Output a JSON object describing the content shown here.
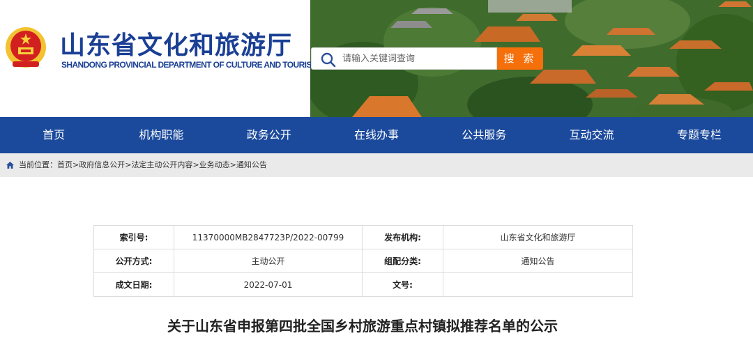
{
  "site": {
    "title_cn": "山东省文化和旅游厅",
    "title_en": "SHANDONG PROVINCIAL DEPARTMENT OF CULTURE AND TOURISM"
  },
  "search": {
    "placeholder": "请输入关键词查询",
    "button_label": "搜 索"
  },
  "nav": {
    "items": [
      {
        "label": "首页"
      },
      {
        "label": "机构职能"
      },
      {
        "label": "政务公开"
      },
      {
        "label": "在线办事"
      },
      {
        "label": "公共服务"
      },
      {
        "label": "互动交流"
      },
      {
        "label": "专题专栏"
      }
    ]
  },
  "breadcrumb": {
    "prefix": "当前位置：",
    "items": [
      "首页",
      "政府信息公开",
      "法定主动公开内容",
      "业务动态",
      "通知公告"
    ],
    "separator": ">"
  },
  "info_table": {
    "index_label": "索引号:",
    "index_value": "11370000MB2847723P/2022-00799",
    "publisher_label": "发布机构:",
    "publisher_value": "山东省文化和旅游厅",
    "disclosure_label": "公开方式:",
    "disclosure_value": "主动公开",
    "category_label": "组配分类:",
    "category_value": "通知公告",
    "date_label": "成文日期:",
    "date_value": "2022-07-01",
    "docno_label": "文号:",
    "docno_value": ""
  },
  "document": {
    "title": "关于山东省申报第四批全国乡村旅游重点村镇拟推荐名单的公示"
  },
  "colors": {
    "brand_blue": "#1a3f95",
    "nav_bg": "#1b4a9c",
    "search_button": "#f56f0a",
    "breadcrumb_bg": "#eaeaea"
  }
}
